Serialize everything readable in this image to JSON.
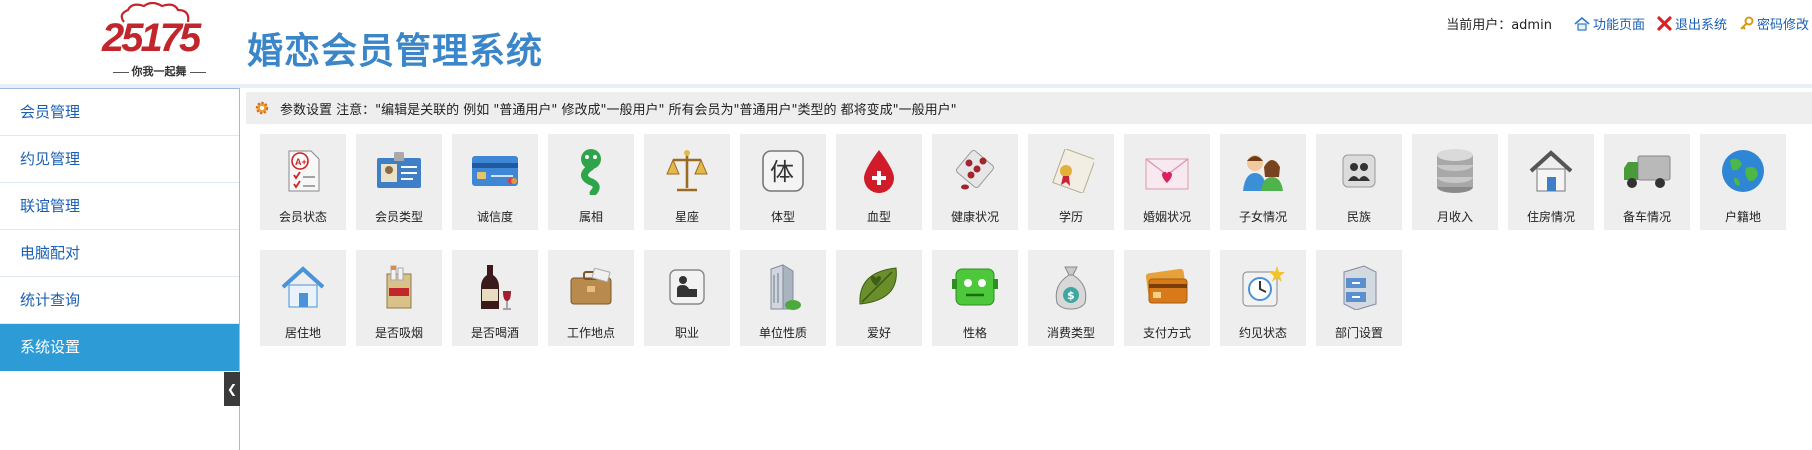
{
  "logo": {
    "number": "25175",
    "slogan": "你我一起舞"
  },
  "app_title": "婚恋会员管理系统",
  "topbar": {
    "user_text": "当前用户：admin",
    "links": [
      "功能页面",
      "退出系统",
      "密码修改"
    ]
  },
  "sidebar": {
    "items": [
      "会员管理",
      "约见管理",
      "联谊管理",
      "电脑配对",
      "统计查询",
      "系统设置"
    ],
    "active": "系统设置"
  },
  "notice": "参数设置  注意：\"编辑是关联的 例如 \"普通用户\" 修改成\"一般用户\" 所有会员为\"普通用户\"类型的 都将变成\"一般用户\"",
  "tiles_row1": [
    "会员状态",
    "会员类型",
    "诚信度",
    "属相",
    "星座",
    "体型",
    "血型",
    "健康状况",
    "学历",
    "婚姻状况",
    "子女情况",
    "民族",
    "月收入",
    "住房情况",
    "备车情况",
    "户籍地"
  ],
  "tiles_row2": [
    "居住地",
    "是否吸烟",
    "是否喝酒",
    "工作地点",
    "职业",
    "单位性质",
    "爱好",
    "性格",
    "消费类型",
    "支付方式",
    "约见状态",
    "部门设置"
  ],
  "icons_row1": [
    "checklist-icon",
    "id-card-icon",
    "credit-card-icon",
    "snake-icon",
    "scales-icon",
    "body-type-icon",
    "blood-drop-icon",
    "pills-icon",
    "certificate-icon",
    "love-letter-icon",
    "children-icon",
    "ethnic-icon",
    "coins-icon",
    "house-icon",
    "truck-icon",
    "globe-icon"
  ],
  "icons_row2": [
    "home-icon",
    "cigarette-icon",
    "wine-icon",
    "briefcase-icon",
    "occupation-icon",
    "building-icon",
    "leaf-icon",
    "character-icon",
    "money-bag-icon",
    "cards-icon",
    "clock-icon",
    "cabinet-icon"
  ],
  "colors": {
    "title": "#3a86c8",
    "nav_text": "#1a5fb4",
    "nav_active_bg": "#2d9bd6",
    "logo_red": "#c0262b"
  }
}
